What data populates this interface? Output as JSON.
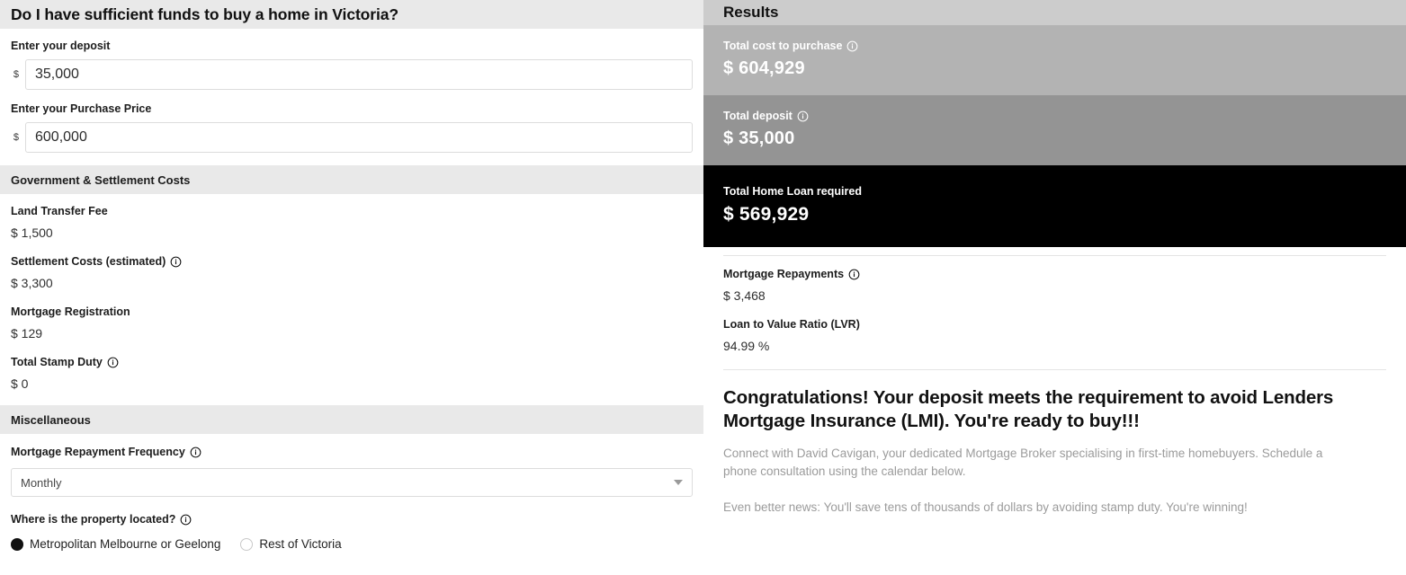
{
  "left": {
    "title": "Do I have sufficient funds to buy a home in Victoria?",
    "deposit": {
      "label": "Enter your deposit",
      "prefix": "$",
      "value": "35,000"
    },
    "purchase_price": {
      "label": "Enter your Purchase Price",
      "prefix": "$",
      "value": "600,000"
    },
    "gov_section": {
      "heading": "Government & Settlement Costs",
      "items": [
        {
          "label": "Land Transfer Fee",
          "value": "$ 1,500",
          "info": false
        },
        {
          "label": "Settlement Costs (estimated)",
          "value": "$ 3,300",
          "info": true
        },
        {
          "label": "Mortgage Registration",
          "value": "$ 129",
          "info": false
        },
        {
          "label": "Total Stamp Duty",
          "value": "$ 0",
          "info": true
        }
      ]
    },
    "misc_section": {
      "heading": "Miscellaneous",
      "frequency": {
        "label": "Mortgage Repayment Frequency",
        "info": true,
        "selected": "Monthly"
      },
      "location": {
        "label": "Where is the property located?",
        "info": true,
        "options": [
          {
            "label": "Metropolitan Melbourne or Geelong",
            "selected": true
          },
          {
            "label": "Rest of Victoria",
            "selected": false
          }
        ]
      }
    }
  },
  "right": {
    "header": "Results",
    "bands": [
      {
        "label": "Total cost to purchase",
        "value": "$ 604,929",
        "info": true,
        "bg": "#b3b3b3"
      },
      {
        "label": "Total deposit",
        "value": "$ 35,000",
        "info": true,
        "bg": "#949494"
      },
      {
        "label": "Total Home Loan required",
        "value": "$ 569,929",
        "info": false,
        "bg": "#000000"
      }
    ],
    "rows": [
      {
        "label": "Mortgage Repayments",
        "value": "$ 3,468",
        "info": true
      },
      {
        "label": "Loan to Value Ratio (LVR)",
        "value": "94.99 %",
        "info": false
      }
    ],
    "message": {
      "heading": "Congratulations! Your deposit meets the requirement to avoid Lenders Mortgage Insurance (LMI). You're ready to buy!!!",
      "paragraph_1": "Connect with David Cavigan, your dedicated Mortgage Broker specialising in first-time homebuyers. Schedule a phone consultation using the calendar below.",
      "paragraph_2": "Even better news: You'll save tens of thousands of dollars by avoiding stamp duty. You're winning!"
    }
  },
  "colors": {
    "section_bar": "#e9e9e9",
    "results_header": "#cccccc",
    "band_1": "#b3b3b3",
    "band_2": "#949494",
    "band_3": "#000000",
    "muted_text": "#9b9b9b"
  }
}
